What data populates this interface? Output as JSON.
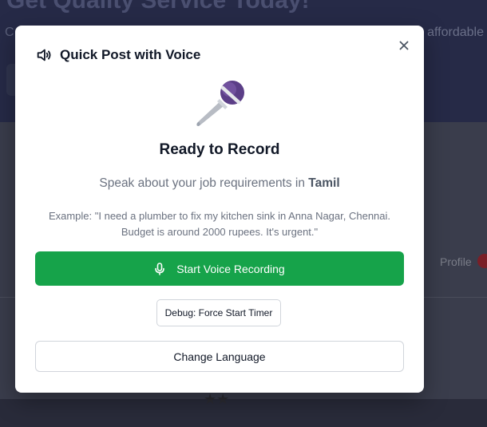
{
  "background": {
    "headline": "Get Quality Service Today!",
    "subtitle_left": "C",
    "subtitle_right": "affordable",
    "profile_label": "Profile"
  },
  "modal": {
    "title": "Quick Post with Voice",
    "title_icon": "speaker-icon",
    "close_icon": "close-icon",
    "illustration_icon": "microphone-icon",
    "status_heading": "Ready to Record",
    "prompt_prefix": "Speak about your job requirements in ",
    "language": "Tamil",
    "example": "Example: \"I need a plumber to fix my kitchen sink in Anna Nagar, Chennai. Budget is around 2000 rupees. It's urgent.\"",
    "start_button": {
      "label": "Start Voice Recording",
      "icon": "microphone-icon",
      "color": "#16a34a"
    },
    "debug_button": {
      "label": "Debug: Force Start Timer"
    },
    "change_language_button": {
      "label": "Change Language"
    }
  }
}
